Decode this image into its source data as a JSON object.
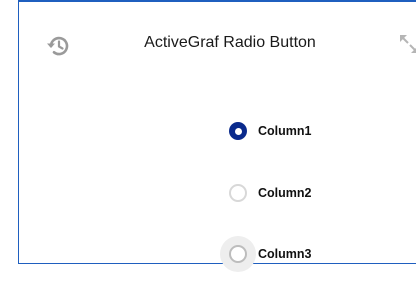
{
  "widget": {
    "title": "ActiveGraf Radio Button",
    "history_icon": "history-icon",
    "expand_icon": "expand-icon",
    "accent_color": "#0a2a8c",
    "border_color": "#1f5fbf"
  },
  "radio_group": {
    "options": [
      {
        "label": "Column1",
        "checked": true
      },
      {
        "label": "Column2",
        "checked": false
      },
      {
        "label": "Column3",
        "checked": false,
        "hovered": true
      }
    ]
  }
}
